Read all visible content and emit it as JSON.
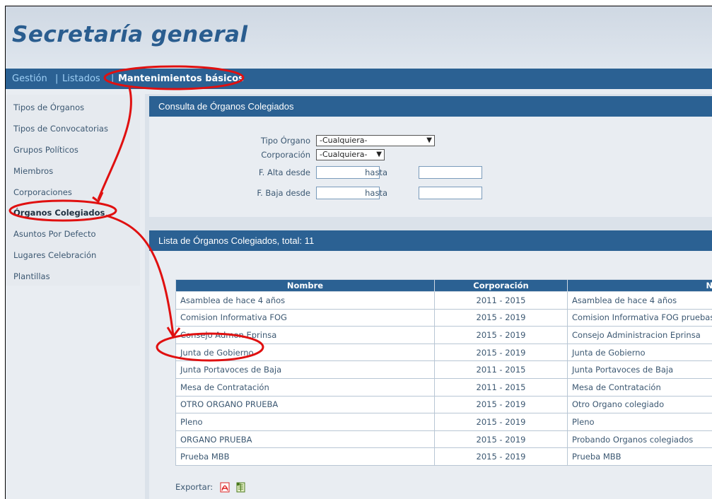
{
  "app": {
    "title": "Secretaría general"
  },
  "topnav": {
    "items": [
      {
        "label": "Gestión"
      },
      {
        "label": "Listados"
      },
      {
        "label": "Mantenimientos básicos"
      }
    ],
    "separator": "|"
  },
  "sidebar": {
    "items": [
      {
        "label": "Tipos de Órganos"
      },
      {
        "label": "Tipos de Convocatorias"
      },
      {
        "label": "Grupos Políticos"
      },
      {
        "label": "Miembros"
      },
      {
        "label": "Corporaciones"
      },
      {
        "label": "Órganos Colegiados"
      },
      {
        "label": "Asuntos Por Defecto"
      },
      {
        "label": "Lugares Celebración"
      },
      {
        "label": "Plantillas"
      }
    ],
    "active": "Órganos Colegiados"
  },
  "filter": {
    "title": "Consulta de Órganos Colegiados",
    "tipo_label": "Tipo Órgano",
    "tipo_value": "-Cualquiera-",
    "corp_label": "Corporación",
    "corp_value": "-Cualquiera-",
    "alta_label": "F. Alta desde",
    "baja_label": "F. Baja desde",
    "hasta_label": "hasta"
  },
  "list": {
    "title": "Lista de Órganos Colegiados, total: 11",
    "columns": [
      "Nombre",
      "Corporación",
      "No"
    ],
    "rows": [
      [
        "Asamblea de hace 4 años",
        "2011 - 2015",
        "Asamblea de hace 4 años"
      ],
      [
        "Comision Informativa FOG",
        "2015 - 2019",
        "Comision Informativa FOG pruebas"
      ],
      [
        "Consejo Admon Eprinsa",
        "2015 - 2019",
        "Consejo Administracion Eprinsa"
      ],
      [
        "Junta de Gobierno",
        "2015 - 2019",
        "Junta de Gobierno"
      ],
      [
        "Junta Portavoces de Baja",
        "2011 - 2015",
        "Junta Portavoces de Baja"
      ],
      [
        "Mesa de Contratación",
        "2011 - 2015",
        "Mesa de Contratación"
      ],
      [
        "OTRO ORGANO PRUEBA",
        "2015 - 2019",
        "Otro Organo colegiado"
      ],
      [
        "Pleno",
        "2015 - 2019",
        "Pleno"
      ],
      [
        "ORGANO PRUEBA",
        "2015 - 2019",
        "Probando Organos colegiados"
      ],
      [
        "Prueba MBB",
        "2015 - 2019",
        "Prueba MBB"
      ]
    ],
    "export_label": "Exportar:"
  },
  "icons": {
    "pdf": "pdf-export-icon",
    "excel": "excel-export-icon"
  },
  "colors": {
    "header_blue": "#2b6193",
    "title_blue": "#2a5d8f",
    "annotation_red": "#e01010"
  }
}
